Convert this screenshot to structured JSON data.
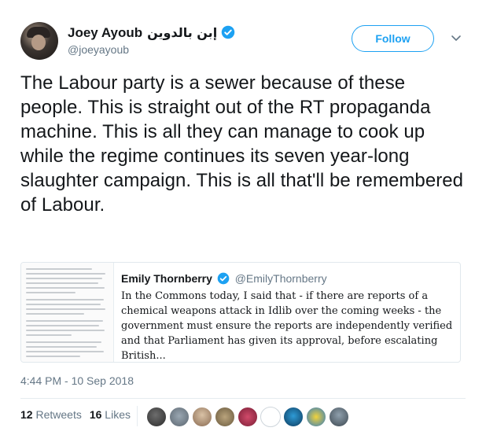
{
  "user": {
    "name": "Joey Ayoub",
    "name_arabic": "إبن بالدوين",
    "handle": "@joeyayoub"
  },
  "follow_button": {
    "label": "Follow"
  },
  "tweet": {
    "text": "The Labour party is a sewer because of these people. This is straight out of the RT propaganda machine. This is all they can manage to cook up while the regime continues its seven year-long slaughter campaign. This is all that'll be remembered of Labour."
  },
  "quoted_tweet": {
    "name": "Emily Thornberry",
    "handle": "@EmilyThornberry",
    "text": "In the Commons today, I said that - if there are reports of a chemical weapons attack in Idlib over the coming weeks - the government must ensure the reports are independently verified and that Parliament has given its approval, before escalating British..."
  },
  "timestamp": "4:44 PM - 10 Sep 2018",
  "stats": {
    "retweets_count": "12",
    "retweets_label": "Retweets",
    "likes_count": "16",
    "likes_label": "Likes"
  },
  "colors": {
    "accent": "#1da1f2",
    "secondary_text": "#657786",
    "border": "#e1e8ed"
  },
  "icons": {
    "verified": "verified-badge-icon",
    "caret": "chevron-down-icon"
  }
}
